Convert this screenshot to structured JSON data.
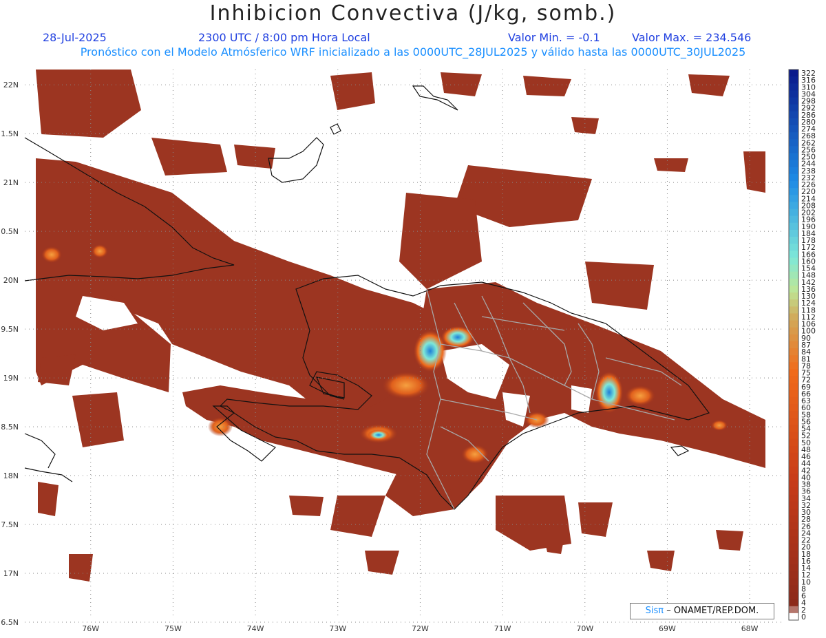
{
  "header": {
    "title": "Inhibicion Convectiva (J/kg, somb.)",
    "date": "28-Jul-2025",
    "time": "2300 UTC / 8:00 pm Hora Local",
    "min_label": "Valor Min. = -0.1",
    "max_label": "Valor Max. = 234.546",
    "forecast": "Pronóstico con el Modelo Atmósferico WRF inicializado a las 0000UTC_28JUL2025 y válido hasta las  0000UTC_30JUL2025"
  },
  "map": {
    "lon_ticks": [
      "76W",
      "75W",
      "74W",
      "73W",
      "72W",
      "71W",
      "70W",
      "69W",
      "68W"
    ],
    "lon_values": [
      -76,
      -75,
      -74,
      -73,
      -72,
      -71,
      -70,
      -69,
      -68
    ],
    "lat_ticks": [
      "22N",
      "1.5N",
      "21N",
      "0.5N",
      "20N",
      "9.5N",
      "19N",
      "8.5N",
      "18N",
      "7.5N",
      "17N",
      "6.5N"
    ],
    "lat_values": [
      22,
      21.5,
      21,
      20.5,
      20,
      19.5,
      19,
      18.5,
      18,
      17.5,
      17,
      16.5
    ],
    "lon_range": [
      -76.8,
      -67.6
    ],
    "lat_range": [
      16.5,
      22.1
    ]
  },
  "colorbar": {
    "labels": [
      "322",
      "316",
      "310",
      "304",
      "298",
      "292",
      "286",
      "280",
      "274",
      "268",
      "262",
      "256",
      "250",
      "244",
      "238",
      "232",
      "226",
      "220",
      "214",
      "208",
      "202",
      "196",
      "190",
      "184",
      "178",
      "172",
      "166",
      "160",
      "154",
      "148",
      "142",
      "136",
      "130",
      "124",
      "118",
      "112",
      "106",
      "100",
      "90",
      "87",
      "84",
      "81",
      "78",
      "75",
      "72",
      "69",
      "66",
      "63",
      "60",
      "58",
      "56",
      "54",
      "52",
      "50",
      "48",
      "46",
      "44",
      "42",
      "40",
      "38",
      "36",
      "34",
      "32",
      "30",
      "28",
      "26",
      "24",
      "22",
      "20",
      "18",
      "16",
      "14",
      "12",
      "10",
      "8",
      "6",
      "4",
      "2",
      "0"
    ],
    "color_low": "#8b2a1a",
    "color_mid": "#f06a1a",
    "color_cyan": "#7fe8d8",
    "color_high": "#0a1a8c"
  },
  "branding": {
    "sis": "Sisπ",
    "org": "– ONAMET/REP.DOM."
  }
}
